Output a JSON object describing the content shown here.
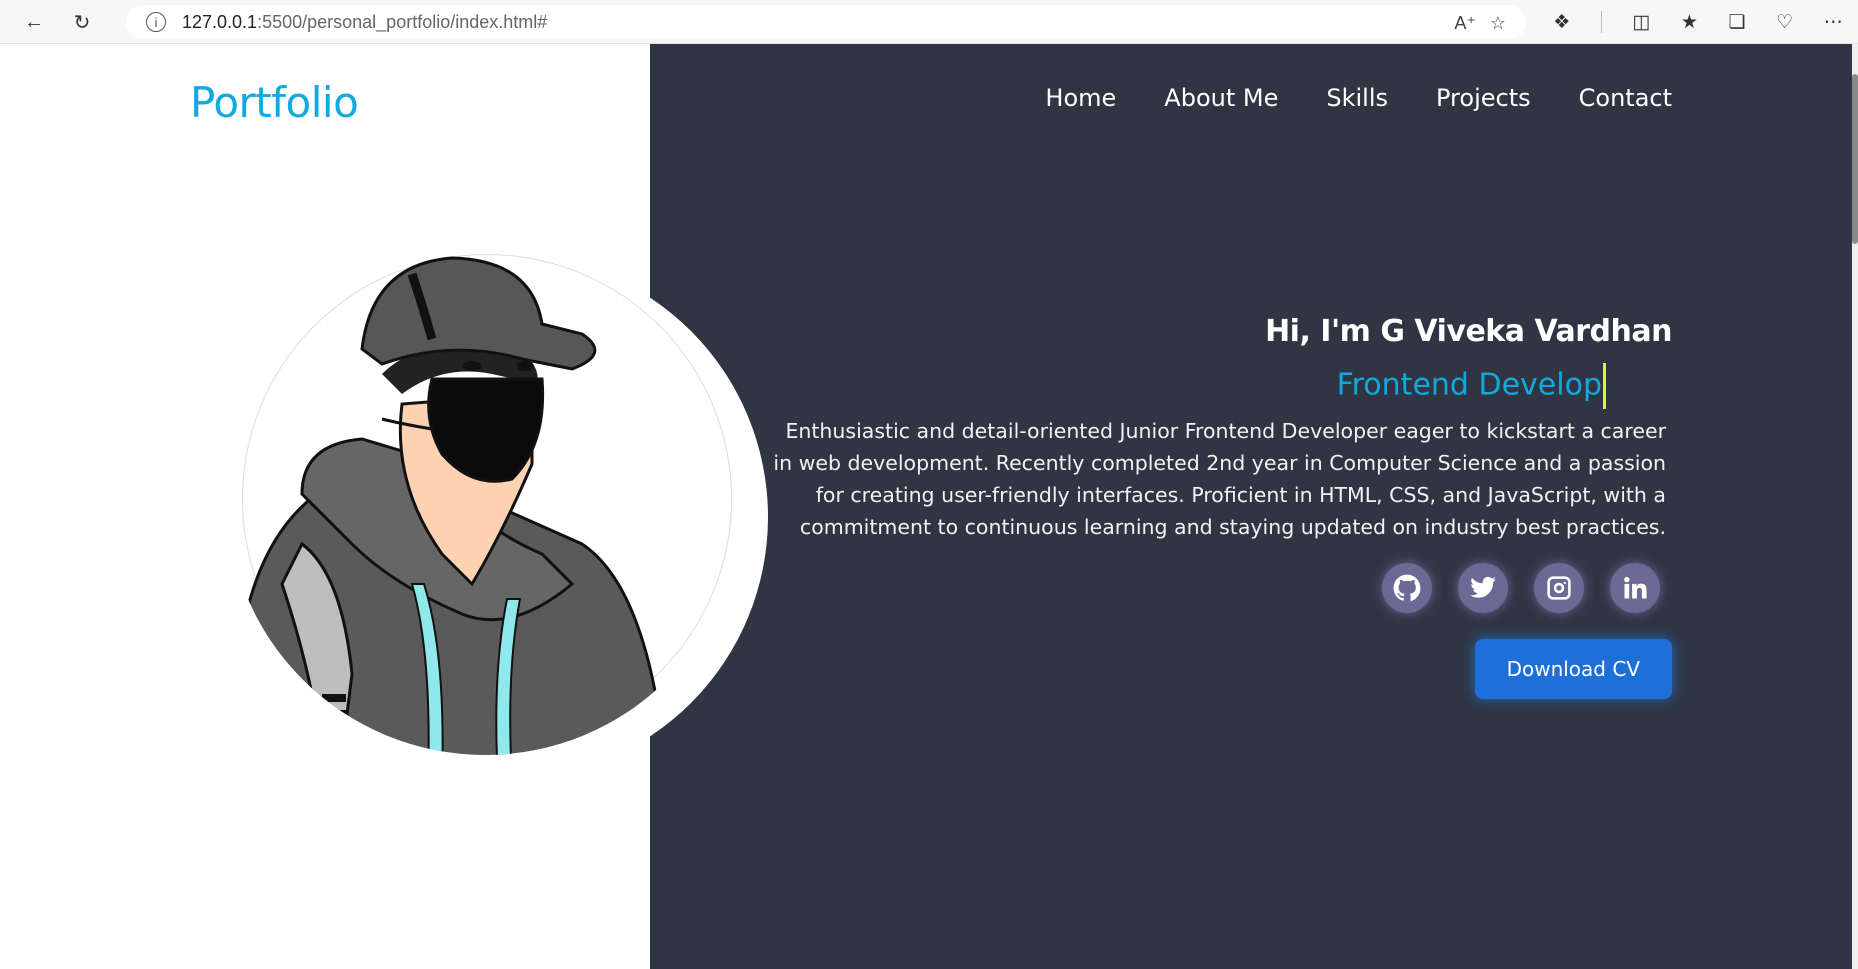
{
  "browser": {
    "url_host": "127.0.0.1",
    "url_path": ":5500/personal_portfolio/index.html#"
  },
  "header": {
    "logo": "Portfolio",
    "nav": [
      "Home",
      "About Me",
      "Skills",
      "Projects",
      "Contact"
    ]
  },
  "hero": {
    "greeting": "Hi, I'm G Viveka Vardhan",
    "role_typed": "Frontend Develop",
    "bio": "Enthusiastic and detail-oriented Junior Frontend Developer eager to kickstart a career in web development. Recently completed 2nd year in Computer Science and a passion for creating user-friendly interfaces. Proficient in HTML, CSS, and JavaScript, with a commitment to continuous learning and staying updated on industry best practices.",
    "socials": [
      "github-icon",
      "twitter-icon",
      "instagram-icon",
      "linkedin-icon"
    ],
    "cta": "Download CV"
  },
  "colors": {
    "accent": "#12a9e0",
    "dark_bg": "#2f3542",
    "button": "#1f6fd8",
    "social_bg": "#6c6a94"
  }
}
